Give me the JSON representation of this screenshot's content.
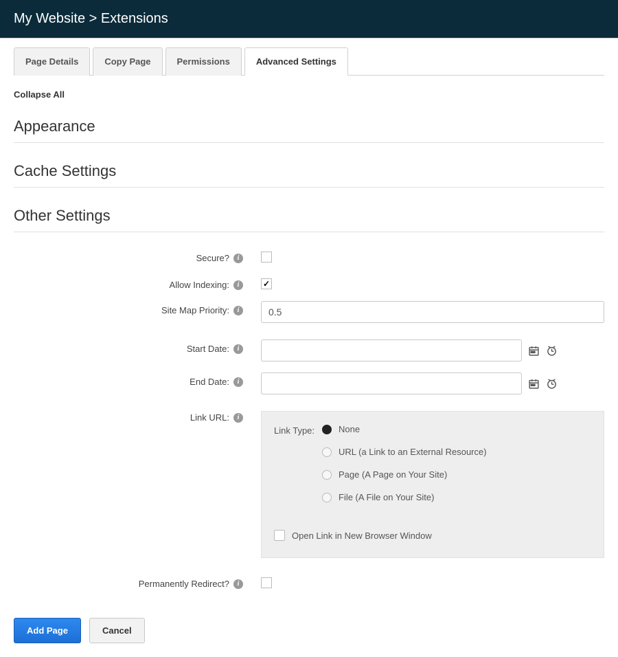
{
  "header": {
    "breadcrumb_site": "My Website",
    "sep": ">",
    "breadcrumb_page": "Extensions"
  },
  "tabs": [
    {
      "label": "Page Details"
    },
    {
      "label": "Copy Page"
    },
    {
      "label": "Permissions"
    },
    {
      "label": "Advanced Settings"
    }
  ],
  "active_tab_index": 3,
  "collapse_all_label": "Collapse All",
  "sections": {
    "appearance": "Appearance",
    "cache_settings": "Cache Settings",
    "other_settings": "Other Settings"
  },
  "other_settings": {
    "secure_label": "Secure?",
    "secure_checked": false,
    "allow_indexing_label": "Allow Indexing:",
    "allow_indexing_checked": true,
    "site_map_priority_label": "Site Map Priority:",
    "site_map_priority_value": "0.5",
    "start_date_label": "Start Date:",
    "start_date_value": "",
    "end_date_label": "End Date:",
    "end_date_value": "",
    "link_url_label": "Link URL:",
    "link_type_label": "Link Type:",
    "link_type_options": [
      {
        "value": "none",
        "label": "None",
        "selected": true
      },
      {
        "value": "url",
        "label": "URL (a Link to an External Resource)",
        "selected": false
      },
      {
        "value": "page",
        "label": "Page (A Page on Your Site)",
        "selected": false
      },
      {
        "value": "file",
        "label": "File (A File on Your Site)",
        "selected": false
      }
    ],
    "open_link_new_window_label": "Open Link in New Browser Window",
    "open_link_new_window_checked": false,
    "permanently_redirect_label": "Permanently Redirect?",
    "permanently_redirect_checked": false
  },
  "buttons": {
    "add_page": "Add Page",
    "cancel": "Cancel"
  },
  "icons": {
    "info": "i"
  }
}
